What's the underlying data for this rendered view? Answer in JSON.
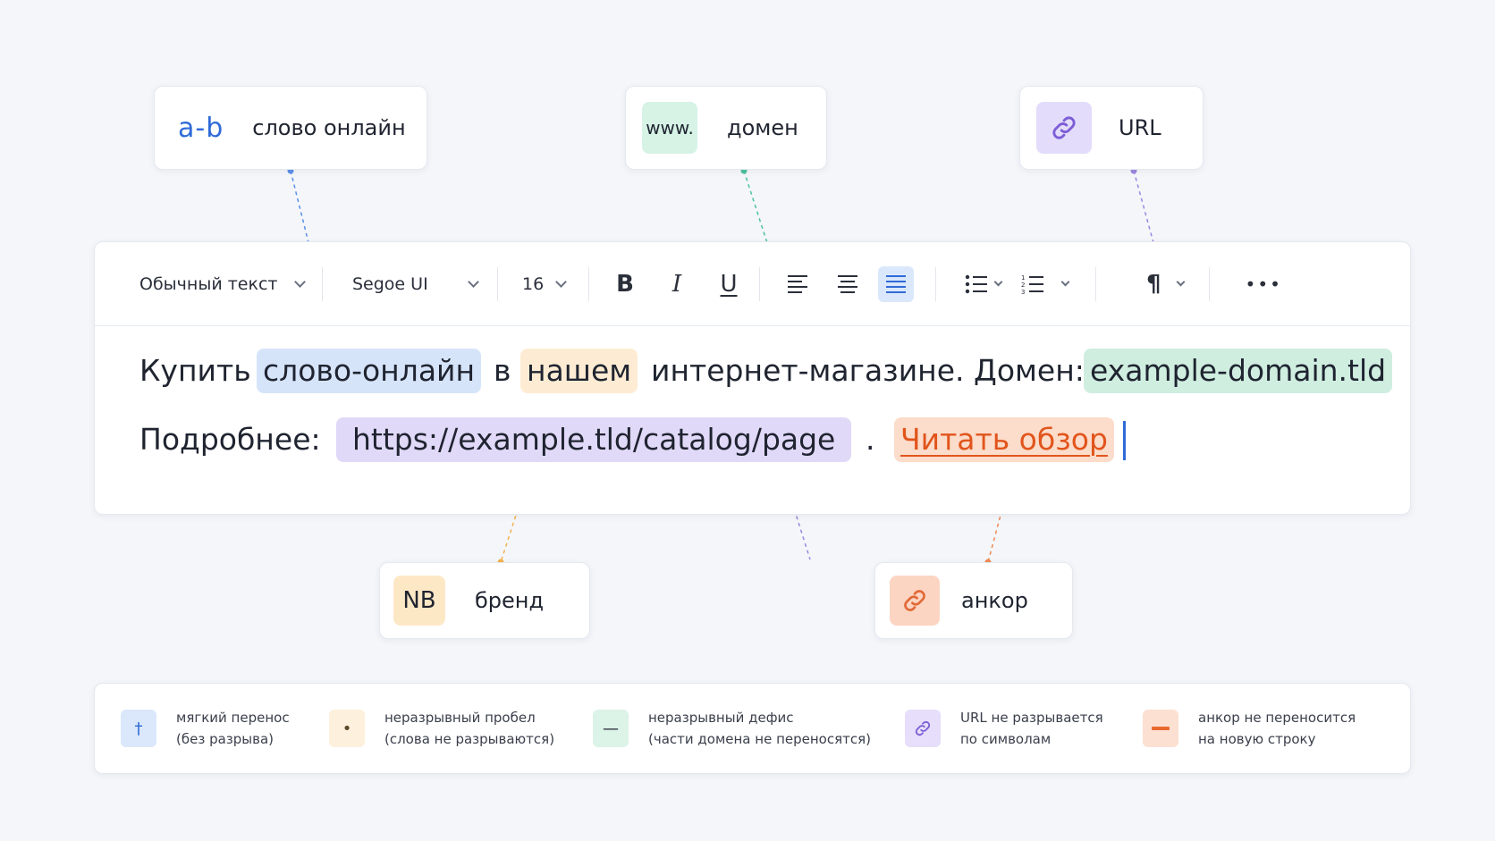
{
  "callouts": {
    "soft_hyphen": {
      "glyph": "a-b",
      "label": "слово онлайн"
    },
    "domain": {
      "glyph": "www.",
      "label": "домен"
    },
    "url": {
      "icon": "link-icon",
      "label": "URL"
    },
    "brand": {
      "glyph": "NB",
      "label": "бренд"
    },
    "anchor": {
      "icon": "link-icon",
      "label": "анкор"
    }
  },
  "toolbar": {
    "style_select": "Обычный текст",
    "font_select": "Segoe UI",
    "size_select": "16",
    "bold": "B",
    "italic": "I",
    "underline": "U",
    "paragraph_mark": "¶",
    "more": "•••"
  },
  "editor": {
    "line1": {
      "w1": "Купить",
      "w2": "слово-онлайн",
      "w3": "в",
      "w4": "нашем",
      "w5": "интернет-магазине. Домен:",
      "w6": "example-domain.tld",
      "w7": "."
    },
    "line2": {
      "w1": "Подробнее:",
      "w2": "https://example.tld/catalog/page",
      "w3": ".",
      "w4": "Читать обзор"
    }
  },
  "legend": [
    {
      "icon": "soft-hyphen-icon",
      "glyph": "†",
      "line1": "мягкий перенос",
      "line2": "(без разрыва)",
      "color": "#dbe7fb"
    },
    {
      "icon": "dot-icon",
      "glyph": "•",
      "line1": "неразрывный пробел",
      "line2": "(слова не разрываются)",
      "color": "#fdf0dc"
    },
    {
      "icon": "dash-icon",
      "glyph": "—",
      "line1": "неразрывный дефис",
      "line2": "(части домена не переносятся)",
      "color": "#dcf3e8"
    },
    {
      "icon": "link-icon",
      "glyph": "",
      "line1": "URL не разрывается",
      "line2": "по символам",
      "color": "#e6defa"
    },
    {
      "icon": "bar-icon",
      "glyph": "",
      "line1": "анкор не переносится",
      "line2": "на новую строку",
      "color": "#fce0d2"
    }
  ],
  "colors": {
    "accent": "#2f6bd8",
    "green": "#3dbb8a",
    "purple": "#8c72dc",
    "amber": "#f2b24d",
    "orange": "#e9682f"
  }
}
